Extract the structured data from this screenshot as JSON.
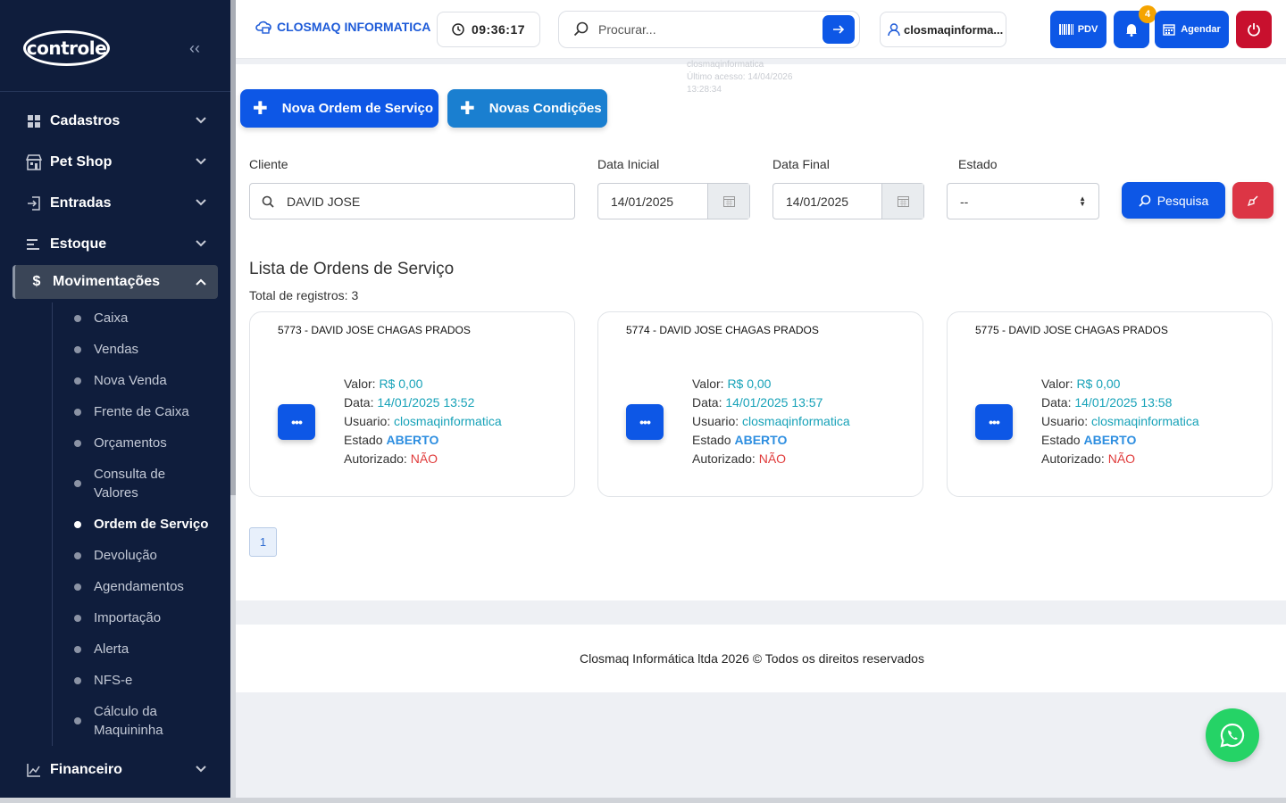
{
  "sidebar": {
    "logo_text": "controle",
    "menu": [
      {
        "label": "Cadastros",
        "icon": "grid-icon"
      },
      {
        "label": "Pet Shop",
        "icon": "store-icon"
      },
      {
        "label": "Entradas",
        "icon": "login-icon"
      },
      {
        "label": "Estoque",
        "icon": "list-icon"
      },
      {
        "label": "Movimentações",
        "icon": "dollar-icon"
      },
      {
        "label": "Financeiro",
        "icon": "chart-line-icon"
      }
    ],
    "submenu": [
      "Caixa",
      "Vendas",
      "Nova Venda",
      "Frente de Caixa",
      "Orçamentos",
      "Consulta de Valores",
      "Ordem de Serviço",
      "Devolução",
      "Agendamentos",
      "Importação",
      "Alerta",
      "NFS-e",
      "Cálculo da Maquininha"
    ],
    "current_submenu": "Ordem de Serviço"
  },
  "topbar": {
    "brand": "CLOSMAQ INFORMATICA",
    "clock": "09:36:17",
    "search_placeholder": "Procurar...",
    "user": "closmaqinforma...",
    "user_hint_name": "closmaqinformatica",
    "user_hint_last": "Último acesso: 14/04/2026 13:28:34",
    "pdv_label": "PDV",
    "notif_count": "4",
    "agendar_label": "Agendar"
  },
  "actions": {
    "nova_os": "Nova Ordem de Serviço",
    "novas_condicoes": "Novas Condições"
  },
  "filters": {
    "cliente_label": "Cliente",
    "cliente_value": "DAVID JOSE",
    "data_inicial_label": "Data Inicial",
    "data_inicial_value": "14/01/2025",
    "data_final_label": "Data Final",
    "data_final_value": "14/01/2025",
    "estado_label": "Estado",
    "estado_value": "--",
    "pesquisa_label": "Pesquisa"
  },
  "list": {
    "title": "Lista de Ordens de Serviço",
    "total_label": "Total de registros:",
    "total_value": "3",
    "field_valor": "Valor:",
    "field_data": "Data:",
    "field_usuario": "Usuario:",
    "field_estado": "Estado",
    "field_autorizado": "Autorizado:",
    "more_label": "•••",
    "orders": [
      {
        "header": "5773 - DAVID JOSE CHAGAS PRADOS",
        "valor": "R$ 0,00",
        "data": "14/01/2025 13:52",
        "usuario": "closmaqinformatica",
        "estado": "ABERTO",
        "autorizado": "NÃO"
      },
      {
        "header": "5774 - DAVID JOSE CHAGAS PRADOS",
        "valor": "R$ 0,00",
        "data": "14/01/2025 13:57",
        "usuario": "closmaqinformatica",
        "estado": "ABERTO",
        "autorizado": "NÃO"
      },
      {
        "header": "5775 - DAVID JOSE CHAGAS PRADOS",
        "valor": "R$ 0,00",
        "data": "14/01/2025 13:58",
        "usuario": "closmaqinformatica",
        "estado": "ABERTO",
        "autorizado": "NÃO"
      }
    ],
    "page": "1"
  },
  "footer": {
    "text": "Closmaq Informática ltda 2026 © Todos os direitos reservados"
  },
  "colors": {
    "sidebar_bg": "#0f1d3c",
    "primary": "#0d57e6",
    "danger": "#dc3545",
    "whatsapp": "#25d366",
    "accent_teal": "#17a2b8"
  }
}
